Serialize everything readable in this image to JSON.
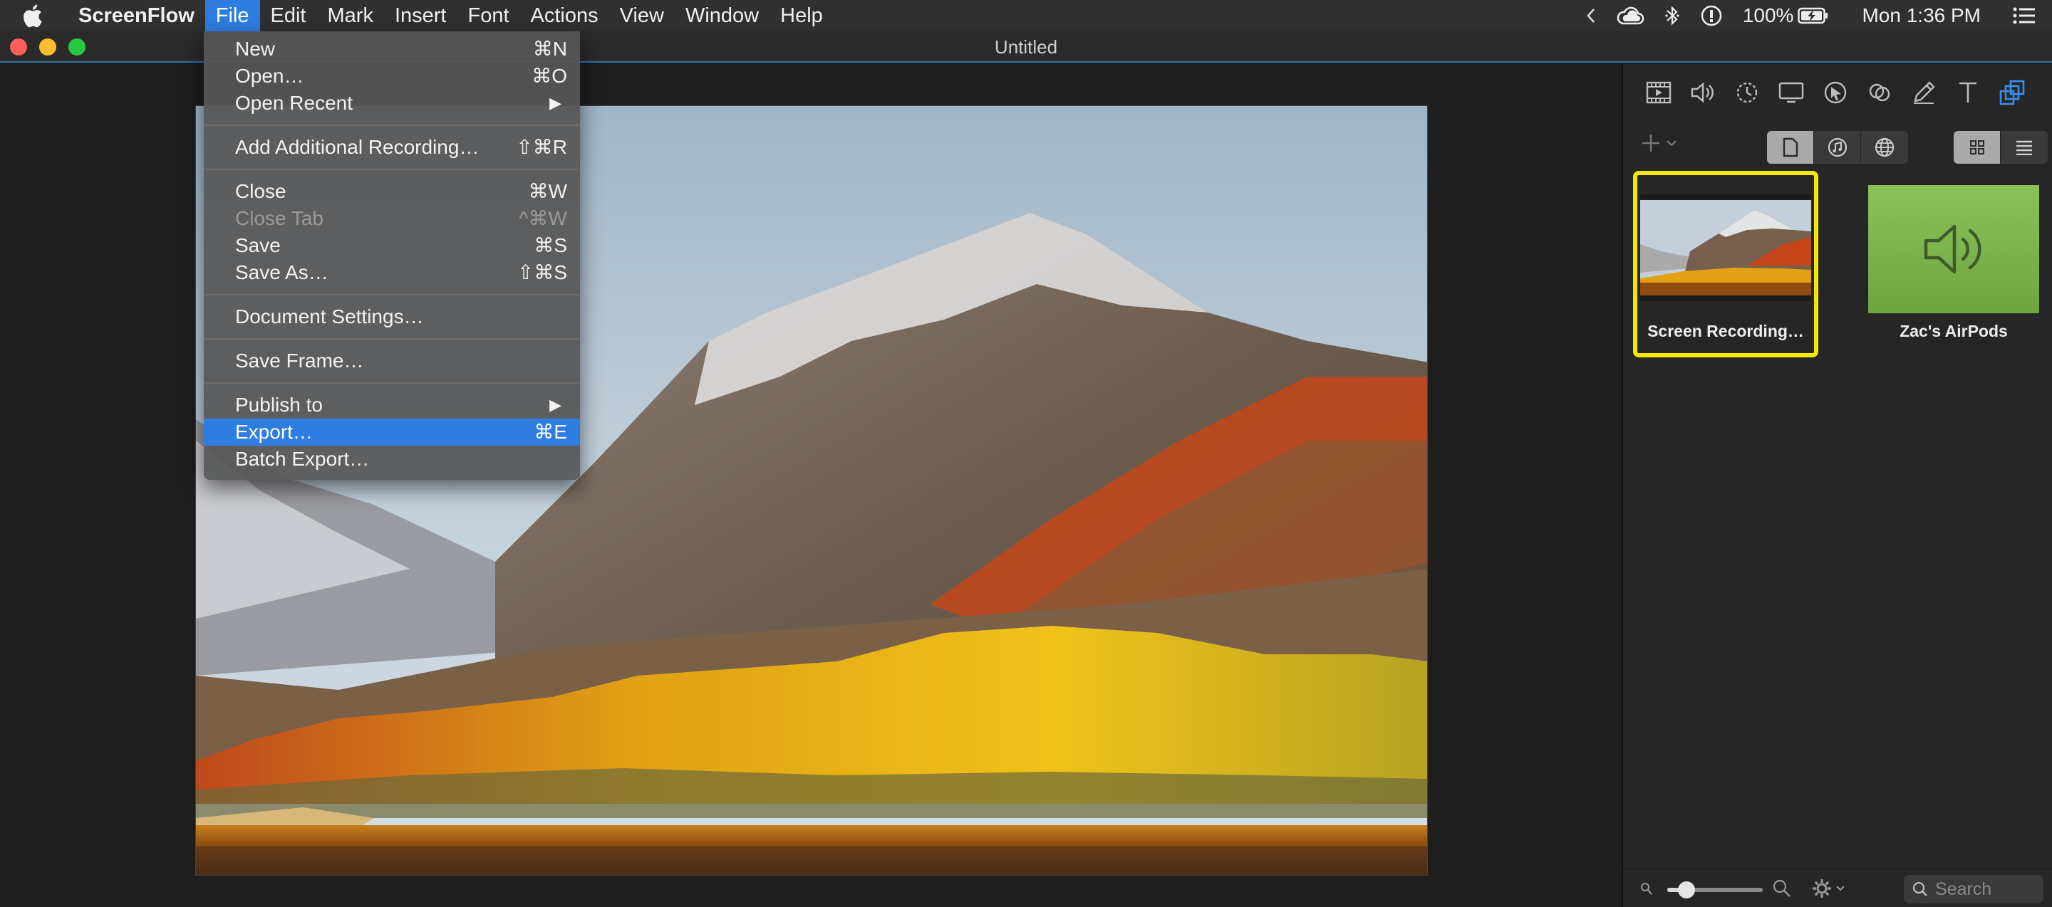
{
  "menubar": {
    "app_name": "ScreenFlow",
    "items": [
      "File",
      "Edit",
      "Mark",
      "Insert",
      "Font",
      "Actions",
      "View",
      "Window",
      "Help"
    ],
    "active_item": "File",
    "status": {
      "battery": "100%",
      "clock": "Mon 1:36 PM"
    }
  },
  "window": {
    "title": "Untitled"
  },
  "file_menu": {
    "items": [
      {
        "label": "New",
        "shortcut": "⌘N"
      },
      {
        "label": "Open…",
        "shortcut": "⌘O"
      },
      {
        "label": "Open Recent",
        "submenu": true
      },
      {
        "label": "Add Additional Recording…",
        "shortcut": "⇧⌘R"
      },
      {
        "label": "Close",
        "shortcut": "⌘W"
      },
      {
        "label": "Close Tab",
        "shortcut": "^⌘W",
        "disabled": true
      },
      {
        "label": "Save",
        "shortcut": "⌘S"
      },
      {
        "label": "Save As…",
        "shortcut": "⇧⌘S"
      },
      {
        "label": "Document Settings…"
      },
      {
        "label": "Save Frame…"
      },
      {
        "label": "Publish to",
        "submenu": true
      },
      {
        "label": "Export…",
        "shortcut": "⌘E",
        "highlighted": true
      },
      {
        "label": "Batch Export…"
      }
    ]
  },
  "inspector": {
    "tabs": [
      "video-properties-icon",
      "audio-properties-icon",
      "video-motion-icon",
      "screen-recording-icon",
      "callout-icon",
      "touch-callout-icon",
      "annotations-icon",
      "text-icon",
      "media-library-icon"
    ],
    "active_tab": "media-library-icon"
  },
  "media_library": {
    "items": [
      {
        "caption": "Screen Recording…",
        "kind": "video",
        "selected": true
      },
      {
        "caption": "Zac's AirPods",
        "kind": "audio",
        "selected": false
      }
    ],
    "search_placeholder": "Search",
    "zoom_level": 0.2
  },
  "colors": {
    "accent": "#2f7de1",
    "selection": "#f4e800",
    "audio_tile": "#7bb34b"
  }
}
